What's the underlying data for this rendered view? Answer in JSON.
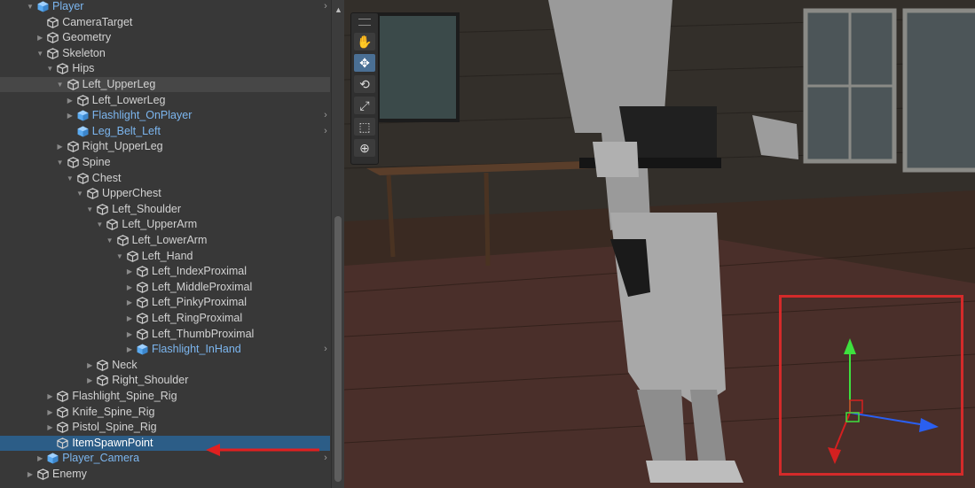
{
  "hierarchy": {
    "items": [
      {
        "label": "Player",
        "depth": 0,
        "fold": "open",
        "prefab": true,
        "chevron": true
      },
      {
        "label": "CameraTarget",
        "depth": 1,
        "fold": "none"
      },
      {
        "label": "Geometry",
        "depth": 1,
        "fold": "closed"
      },
      {
        "label": "Skeleton",
        "depth": 1,
        "fold": "open"
      },
      {
        "label": "Hips",
        "depth": 2,
        "fold": "open"
      },
      {
        "label": "Left_UpperLeg",
        "depth": 3,
        "fold": "open",
        "state": "hover"
      },
      {
        "label": "Left_LowerLeg",
        "depth": 4,
        "fold": "closed"
      },
      {
        "label": "Flashlight_OnPlayer",
        "depth": 4,
        "fold": "closed",
        "prefab": true,
        "chevron": true
      },
      {
        "label": "Leg_Belt_Left",
        "depth": 4,
        "fold": "none",
        "prefab": true,
        "chevron": true
      },
      {
        "label": "Right_UpperLeg",
        "depth": 3,
        "fold": "closed"
      },
      {
        "label": "Spine",
        "depth": 3,
        "fold": "open"
      },
      {
        "label": "Chest",
        "depth": 4,
        "fold": "open"
      },
      {
        "label": "UpperChest",
        "depth": 5,
        "fold": "open"
      },
      {
        "label": "Left_Shoulder",
        "depth": 6,
        "fold": "open"
      },
      {
        "label": "Left_UpperArm",
        "depth": 7,
        "fold": "open"
      },
      {
        "label": "Left_LowerArm",
        "depth": 8,
        "fold": "open"
      },
      {
        "label": "Left_Hand",
        "depth": 9,
        "fold": "open"
      },
      {
        "label": "Left_IndexProximal",
        "depth": 10,
        "fold": "closed"
      },
      {
        "label": "Left_MiddleProximal",
        "depth": 10,
        "fold": "closed"
      },
      {
        "label": "Left_PinkyProximal",
        "depth": 10,
        "fold": "closed"
      },
      {
        "label": "Left_RingProximal",
        "depth": 10,
        "fold": "closed"
      },
      {
        "label": "Left_ThumbProximal",
        "depth": 10,
        "fold": "closed"
      },
      {
        "label": "Flashlight_InHand",
        "depth": 10,
        "fold": "closed",
        "prefab": true,
        "chevron": true
      },
      {
        "label": "Neck",
        "depth": 6,
        "fold": "closed"
      },
      {
        "label": "Right_Shoulder",
        "depth": 6,
        "fold": "closed"
      },
      {
        "label": "Flashlight_Spine_Rig",
        "depth": 2,
        "fold": "closed"
      },
      {
        "label": "Knife_Spine_Rig",
        "depth": 2,
        "fold": "closed"
      },
      {
        "label": "Pistol_Spine_Rig",
        "depth": 2,
        "fold": "closed"
      },
      {
        "label": "ItemSpawnPoint",
        "depth": 2,
        "fold": "none",
        "state": "selected"
      },
      {
        "label": "Player_Camera",
        "depth": 1,
        "fold": "closed",
        "prefab": true,
        "chevron": true
      },
      {
        "label": "Enemy",
        "depth": 0,
        "fold": "closed"
      }
    ]
  },
  "scene_tools": [
    {
      "name": "view-tool",
      "icon": "hand-icon",
      "glyph": "✋",
      "active": false
    },
    {
      "name": "move-tool",
      "icon": "move-icon",
      "glyph": "✥",
      "active": true
    },
    {
      "name": "rotate-tool",
      "icon": "rotate-icon",
      "glyph": "⟲",
      "active": false
    },
    {
      "name": "scale-tool",
      "icon": "scale-icon",
      "glyph": "⤢",
      "active": false
    },
    {
      "name": "rect-tool",
      "icon": "rect-icon",
      "glyph": "⬚",
      "active": false
    },
    {
      "name": "transform-tool",
      "icon": "transform-icon",
      "glyph": "⊕",
      "active": false
    }
  ],
  "gizmo": {
    "y_axis_color": "#3ee03e",
    "x_axis_color": "#2a5ff0",
    "z_axis_color": "#d42020"
  },
  "annotation": {
    "arrow_color": "#e02020",
    "box_color": "#d42a2a"
  },
  "colors": {
    "selection": "#2c5d87",
    "prefab_text": "#7cb6ef",
    "prefab_icon": "#5aaaf0"
  }
}
